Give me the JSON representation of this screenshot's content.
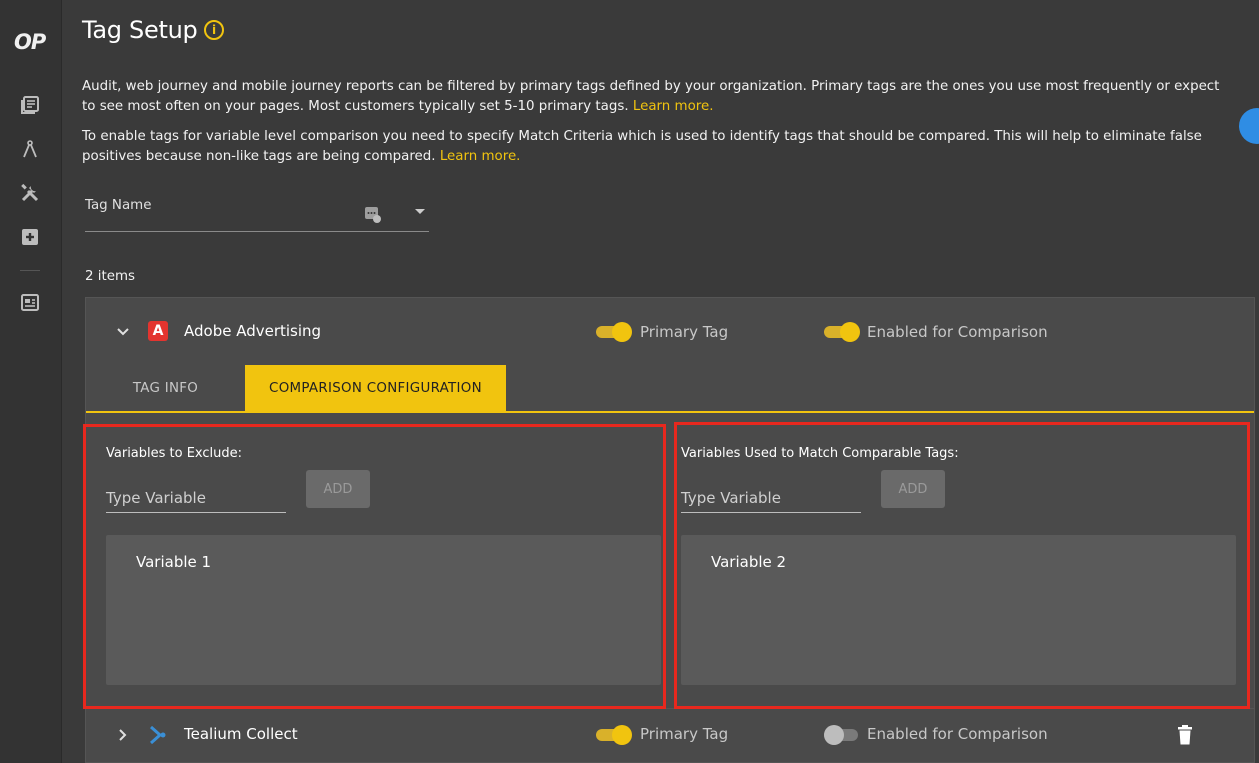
{
  "sidebar": {
    "logo": "OP",
    "icons": [
      "reports-icon",
      "compass-icon",
      "tools-icon",
      "add-icon",
      "calendar-icon"
    ]
  },
  "page": {
    "title": "Tag Setup",
    "intro_1": "Audit, web journey and mobile journey reports can be filtered by primary tags defined by your organization. Primary tags are the ones you use most frequently or expect to see most often on your pages. Most customers typically set 5-10 primary tags.",
    "intro_1_link": "Learn more.",
    "intro_2": "To enable tags for variable level comparison you need to specify Match Criteria which is used to identify tags that should be compared. This will help to eliminate false positives because non-like tags are being compared.",
    "intro_2_link": "Learn more.",
    "filter_label": "Tag Name",
    "items_count": "2 items"
  },
  "tags": [
    {
      "name": "Adobe Advertising",
      "primary_label": "Primary Tag",
      "primary_on": true,
      "comparison_label": "Enabled for Comparison",
      "comparison_on": true,
      "expanded": true,
      "tabs": [
        "TAG INFO",
        "COMPARISON CONFIGURATION"
      ],
      "active_tab": "COMPARISON CONFIGURATION",
      "exclude": {
        "label": "Variables to Exclude:",
        "placeholder": "Type Variable",
        "add": "ADD",
        "items": [
          "Variable 1"
        ]
      },
      "match": {
        "label": "Variables Used to Match Comparable Tags:",
        "placeholder": "Type Variable",
        "add": "ADD",
        "items": [
          "Variable 2"
        ]
      }
    },
    {
      "name": "Tealium Collect",
      "primary_label": "Primary Tag",
      "primary_on": true,
      "comparison_label": "Enabled for Comparison",
      "comparison_on": false,
      "expanded": false
    }
  ],
  "colors": {
    "accent": "#f1c40f",
    "highlight": "#e8281e",
    "background": "#3a3a3a"
  }
}
